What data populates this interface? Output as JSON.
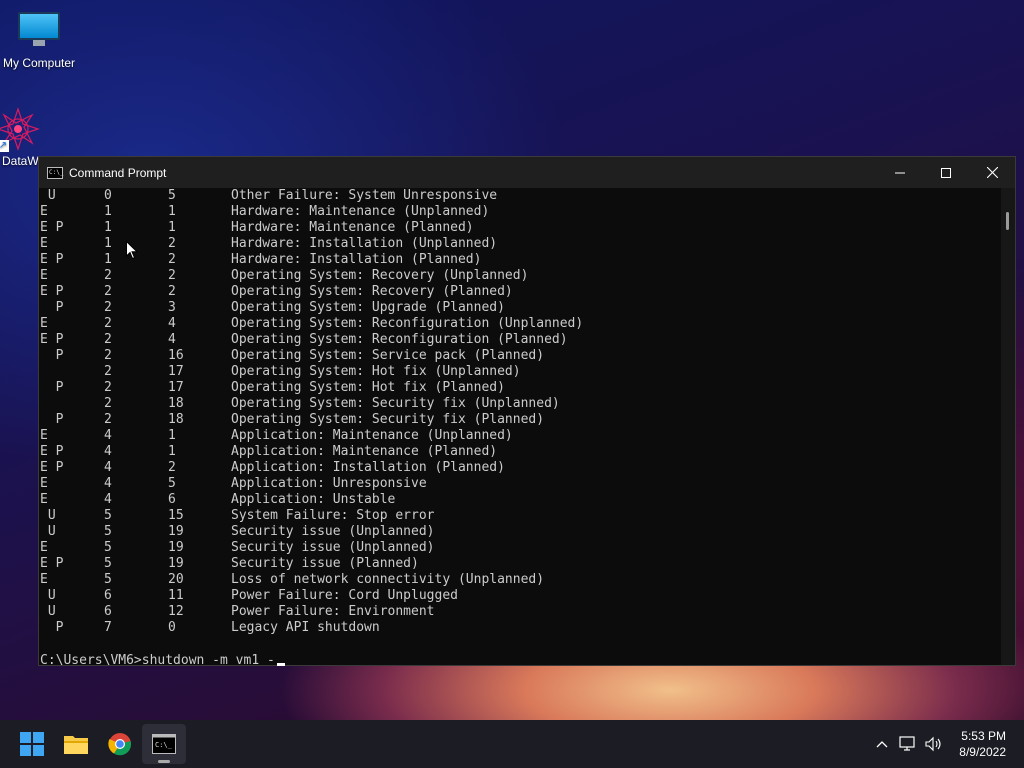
{
  "desktop": {
    "icons": [
      {
        "label": "My Computer"
      },
      {
        "label": "DataW"
      }
    ]
  },
  "window": {
    "title": "Command Prompt",
    "rows": [
      {
        "flag": " U",
        "major": "0",
        "minor": "5",
        "desc": "Other Failure: System Unresponsive"
      },
      {
        "flag": "E",
        "major": "1",
        "minor": "1",
        "desc": "Hardware: Maintenance (Unplanned)"
      },
      {
        "flag": "E P",
        "major": "1",
        "minor": "1",
        "desc": "Hardware: Maintenance (Planned)"
      },
      {
        "flag": "E",
        "major": "1",
        "minor": "2",
        "desc": "Hardware: Installation (Unplanned)"
      },
      {
        "flag": "E P",
        "major": "1",
        "minor": "2",
        "desc": "Hardware: Installation (Planned)"
      },
      {
        "flag": "E",
        "major": "2",
        "minor": "2",
        "desc": "Operating System: Recovery (Unplanned)"
      },
      {
        "flag": "E P",
        "major": "2",
        "minor": "2",
        "desc": "Operating System: Recovery (Planned)"
      },
      {
        "flag": "  P",
        "major": "2",
        "minor": "3",
        "desc": "Operating System: Upgrade (Planned)"
      },
      {
        "flag": "E",
        "major": "2",
        "minor": "4",
        "desc": "Operating System: Reconfiguration (Unplanned)"
      },
      {
        "flag": "E P",
        "major": "2",
        "minor": "4",
        "desc": "Operating System: Reconfiguration (Planned)"
      },
      {
        "flag": "  P",
        "major": "2",
        "minor": "16",
        "desc": "Operating System: Service pack (Planned)"
      },
      {
        "flag": "",
        "major": "2",
        "minor": "17",
        "desc": "Operating System: Hot fix (Unplanned)"
      },
      {
        "flag": "  P",
        "major": "2",
        "minor": "17",
        "desc": "Operating System: Hot fix (Planned)"
      },
      {
        "flag": "",
        "major": "2",
        "minor": "18",
        "desc": "Operating System: Security fix (Unplanned)"
      },
      {
        "flag": "  P",
        "major": "2",
        "minor": "18",
        "desc": "Operating System: Security fix (Planned)"
      },
      {
        "flag": "E",
        "major": "4",
        "minor": "1",
        "desc": "Application: Maintenance (Unplanned)"
      },
      {
        "flag": "E P",
        "major": "4",
        "minor": "1",
        "desc": "Application: Maintenance (Planned)"
      },
      {
        "flag": "E P",
        "major": "4",
        "minor": "2",
        "desc": "Application: Installation (Planned)"
      },
      {
        "flag": "E",
        "major": "4",
        "minor": "5",
        "desc": "Application: Unresponsive"
      },
      {
        "flag": "E",
        "major": "4",
        "minor": "6",
        "desc": "Application: Unstable"
      },
      {
        "flag": " U",
        "major": "5",
        "minor": "15",
        "desc": "System Failure: Stop error"
      },
      {
        "flag": " U",
        "major": "5",
        "minor": "19",
        "desc": "Security issue (Unplanned)"
      },
      {
        "flag": "E",
        "major": "5",
        "minor": "19",
        "desc": "Security issue (Unplanned)"
      },
      {
        "flag": "E P",
        "major": "5",
        "minor": "19",
        "desc": "Security issue (Planned)"
      },
      {
        "flag": "E",
        "major": "5",
        "minor": "20",
        "desc": "Loss of network connectivity (Unplanned)"
      },
      {
        "flag": " U",
        "major": "6",
        "minor": "11",
        "desc": "Power Failure: Cord Unplugged"
      },
      {
        "flag": " U",
        "major": "6",
        "minor": "12",
        "desc": "Power Failure: Environment"
      },
      {
        "flag": "  P",
        "major": "7",
        "minor": "0",
        "desc": "Legacy API shutdown"
      }
    ],
    "prompt": "C:\\Users\\VM6>shutdown -m vm1 -"
  },
  "taskbar": {
    "apps": [
      "start-icon",
      "file-explorer-icon",
      "chrome-icon",
      "command-prompt-icon"
    ],
    "time": "5:53 PM",
    "date": "8/9/2022"
  },
  "colors": {
    "console_bg": "#0c0c0c",
    "console_text": "#cccccc",
    "titlebar": "#1f1f1f",
    "taskbar": "#1c1c24"
  }
}
